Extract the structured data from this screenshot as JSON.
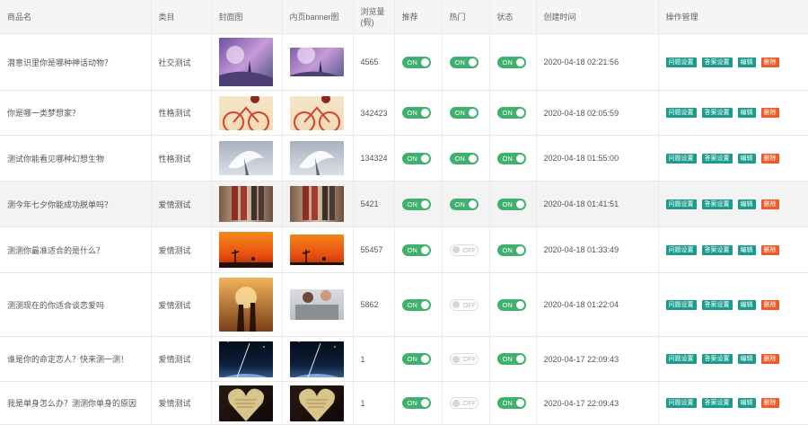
{
  "columns": {
    "name": "商品名",
    "category": "类目",
    "cover": "封面图",
    "banner": "内页banner图",
    "views": "浏览量(假)",
    "recommend": "推荐",
    "hot": "热门",
    "status": "状态",
    "created": "创建时间",
    "ops": "操作管理"
  },
  "toggle_labels": {
    "on": "ON",
    "off": "OFF"
  },
  "op_labels": {
    "question": "问题设置",
    "answer": "答案设置",
    "edit": "编辑",
    "delete": "删除"
  },
  "colors": {
    "toggle_on": "#3fb06d",
    "op_button": "#1a9b8c",
    "delete_button": "#f05a28"
  },
  "rows": [
    {
      "name": "潜意识里你是哪种神话动物？",
      "category": "社交测试",
      "views": "4565",
      "recommend": true,
      "hot": true,
      "status": true,
      "created": "2020-04-18 02:21:56",
      "cover_desc": "fantasy-castle-image",
      "banner_desc": "fantasy-castle-image",
      "answer_op": "答案设置"
    },
    {
      "name": "你是哪一类梦想家？",
      "category": "性格测试",
      "views": "342423",
      "recommend": true,
      "hot": true,
      "status": true,
      "created": "2020-04-18 02:05:59",
      "cover_desc": "bicycle-dream-image",
      "banner_desc": "bicycle-dream-image",
      "answer_op": "答案设置"
    },
    {
      "name": "测试你能看见哪种幻想生物",
      "category": "性格测试",
      "views": "134324",
      "recommend": true,
      "hot": true,
      "status": true,
      "created": "2020-04-18 01:55:00",
      "cover_desc": "white-dragon-image",
      "banner_desc": "white-dragon-image",
      "answer_op": "答案设置"
    },
    {
      "name": "测今年七夕你能成功脱单吗？",
      "category": "爱情测试",
      "views": "5421",
      "recommend": true,
      "hot": true,
      "status": true,
      "created": "2020-04-18 01:41:51",
      "cover_desc": "couple-legs-image",
      "banner_desc": "couple-legs-image",
      "answer_op": "答案设置"
    },
    {
      "name": "测测你最准适合的是什么？",
      "category": "爱情测试",
      "views": "55457",
      "recommend": true,
      "hot": false,
      "status": true,
      "created": "2020-04-18 01:33:49",
      "cover_desc": "orange-sunset-image",
      "banner_desc": "orange-sunset-image",
      "answer_op": "答案设置"
    },
    {
      "name": "测测现在的你适合谈恋爱吗",
      "category": "爱情测试",
      "views": "5862",
      "recommend": true,
      "hot": false,
      "status": true,
      "created": "2020-04-18 01:22:04",
      "cover_desc": "couple-sunset-image",
      "banner_desc": "couple-sofa-image",
      "answer_op": "答案设置"
    },
    {
      "name": "谁是你的命定恋人？快来测一测！",
      "category": "爱情测试",
      "views": "1",
      "recommend": true,
      "hot": false,
      "status": true,
      "created": "2020-04-17 22:09:43",
      "cover_desc": "earth-space-image",
      "banner_desc": "earth-space-image",
      "answer_op": "答案设置"
    },
    {
      "name": "我是单身怎么办？测测你单身的原因",
      "category": "爱情测试",
      "views": "1",
      "recommend": true,
      "hot": false,
      "status": true,
      "created": "2020-04-17 22:09:43",
      "cover_desc": "heart-paper-image",
      "banner_desc": "heart-paper-image",
      "answer_op": "答案设置"
    }
  ]
}
